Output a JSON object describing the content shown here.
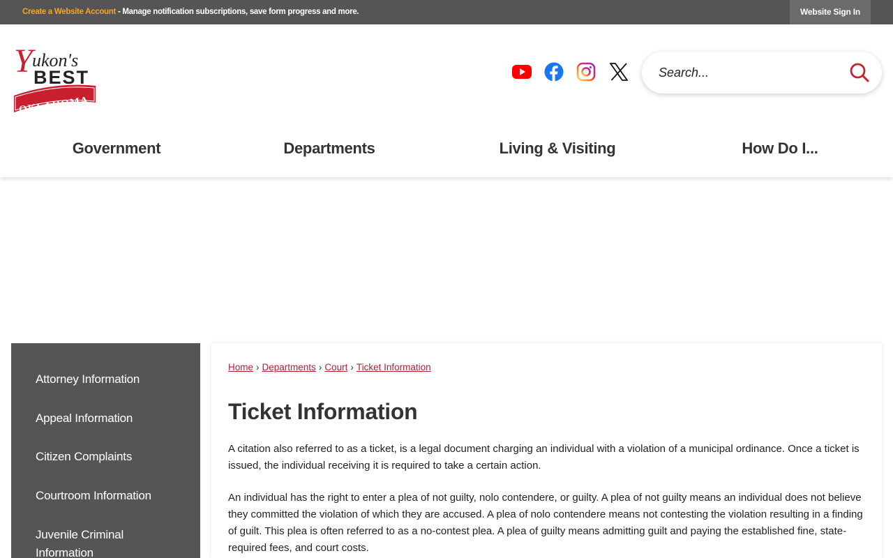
{
  "topbar": {
    "account_link": "Create a Website Account",
    "message": " - Manage notification subscriptions, save form progress and more.",
    "signin_label": "Website Sign In"
  },
  "logo": {
    "line1": "Yukon's",
    "line2": "BEST",
    "line3": "OKLAHOMA"
  },
  "social": [
    "youtube-icon",
    "facebook-icon",
    "instagram-icon",
    "x-icon"
  ],
  "search": {
    "placeholder": "Search..."
  },
  "nav": [
    {
      "label": "Government"
    },
    {
      "label": "Departments"
    },
    {
      "label": "Living & Visiting"
    },
    {
      "label": "How Do I..."
    }
  ],
  "sidebar": {
    "items": [
      {
        "label": "Attorney Information"
      },
      {
        "label": "Appeal Information"
      },
      {
        "label": "Citizen Complaints"
      },
      {
        "label": "Courtroom Information"
      },
      {
        "label": "Juvenile Criminal Information"
      }
    ]
  },
  "breadcrumb": {
    "items": [
      "Home",
      "Departments",
      "Court",
      "Ticket Information"
    ],
    "separator": "›"
  },
  "main": {
    "title": "Ticket Information",
    "paragraphs": [
      "A citation also referred to as a ticket, is a legal document charging an individual with a violation of a municipal ordinance. Once a ticket is issued, the individual receiving it is required to take a certain action.",
      "An individual has the right to enter a plea of not guilty, nolo contendere, or guilty. A plea of not guilty means an individual does not believe they committed the violation of which they are accused. A plea of nolo contendere means not contesting the violation resulting in a finding of guilt. This plea is often referred to as a no-contest plea. A plea of guilty means admitting guilt and paying the established fine, state-required fees, and court costs."
    ]
  },
  "colors": {
    "topbar": "#555555",
    "accent_orange": "#f5a623",
    "brand_red": "#c8202f",
    "link_red": "#b22234",
    "sidebar": "#555555"
  }
}
